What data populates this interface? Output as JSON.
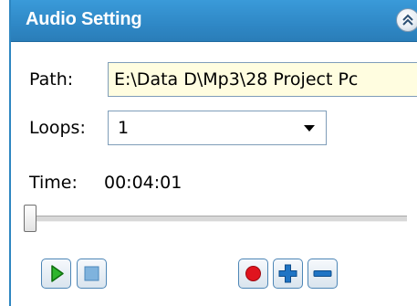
{
  "panel": {
    "title": "Audio Setting",
    "collapse_icon": "double-chevron-up-icon"
  },
  "path": {
    "label": "Path:",
    "value": "E:\\Data D\\Mp3\\28 Project Pc"
  },
  "loops": {
    "label": "Loops:",
    "selected": "1"
  },
  "time": {
    "label": "Time:",
    "value": "00:04:01",
    "slider_position_fraction": 0.0
  },
  "controls": {
    "play_icon": "play-icon",
    "stop_icon": "stop-icon",
    "record_icon": "record-icon",
    "add_icon": "plus-icon",
    "remove_icon": "minus-icon"
  },
  "colors": {
    "header": "#2f88c6",
    "path_field_bg": "#fffde0",
    "play": "#2db52d",
    "stop": "#7fb3dd",
    "record": "#e0141e",
    "add_remove": "#1f74c4"
  }
}
